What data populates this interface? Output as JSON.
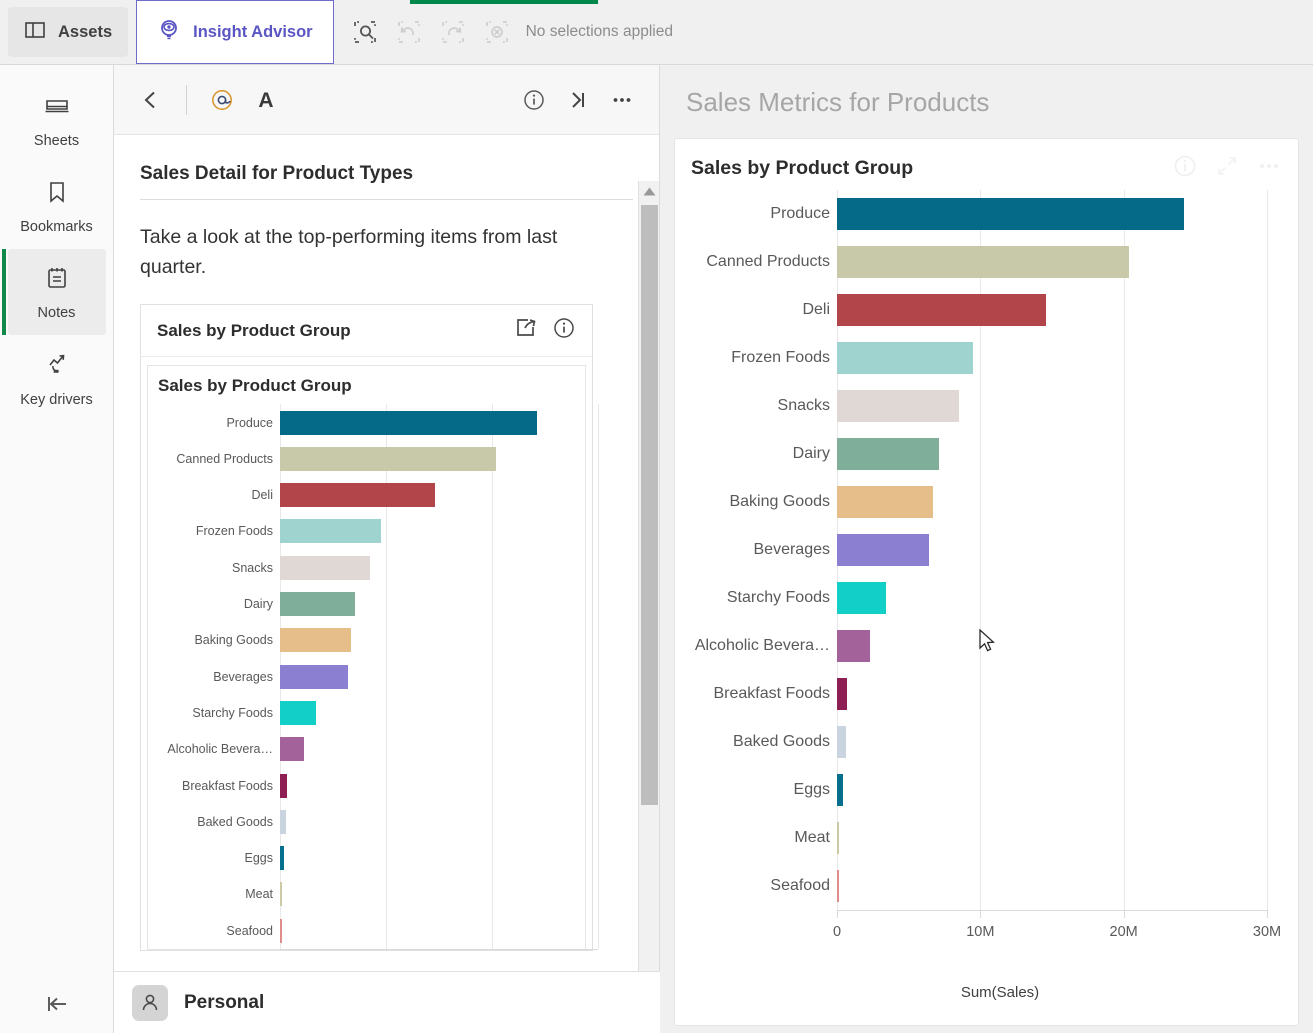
{
  "topbar": {
    "assets_label": "Assets",
    "insight_advisor_label": "Insight Advisor",
    "selection_status": "No selections applied",
    "icons": {
      "assets": "panel-icon",
      "insight_advisor": "lightbulb-eye-icon",
      "selection_search": "selection-search-icon",
      "undo": "undo-icon",
      "redo": "redo-icon",
      "clear": "clear-selections-icon"
    },
    "accent_purple": "#6e6bcc",
    "progress_green": "#00884b"
  },
  "sidebar": {
    "items": [
      {
        "label": "Sheets",
        "icon": "sheets-icon",
        "active": false
      },
      {
        "label": "Bookmarks",
        "icon": "bookmark-icon",
        "active": false
      },
      {
        "label": "Notes",
        "icon": "notes-icon",
        "active": true
      },
      {
        "label": "Key drivers",
        "icon": "key-drivers-icon",
        "active": false
      }
    ],
    "collapse_icon": "collapse-left-icon",
    "active_indicator_color": "#12884a"
  },
  "notes_panel": {
    "toolbar": {
      "back": "back-chevron-icon",
      "mention": "at-mention-icon",
      "text_format": "text-format-icon",
      "info": "info-icon",
      "collapse": "collapse-right-icon",
      "more": "more-options-icon"
    },
    "note_title": "Sales Detail for Product Types",
    "note_paragraph": "Take a look at the top-performing items from last quarter.",
    "embedded_card": {
      "header_title": "Sales by Product Group",
      "share_icon": "share-external-icon",
      "info_icon": "info-icon",
      "chart_title": "Sales by Product Group"
    }
  },
  "right_panel": {
    "title": "Sales Metrics for Products",
    "card": {
      "title": "Sales by Product Group",
      "info_icon": "info-icon",
      "expand_icon": "expand-icon",
      "more_icon": "more-options-icon"
    }
  },
  "bottombar": {
    "avatar_icon": "person-avatar-icon",
    "name": "Personal"
  },
  "colors": {
    "bars": [
      "#056a87",
      "#c8c9a9",
      "#b1454a",
      "#9fd3d0",
      "#e0d8d4",
      "#7fae9a",
      "#e6be8a",
      "#8b7fd1",
      "#12cfc8",
      "#a3629a",
      "#8e1f52",
      "#c9d4de",
      "#08708f",
      "#cdc9a5",
      "#de8c8c"
    ]
  },
  "chart_data": {
    "type": "bar",
    "orientation": "horizontal",
    "title": "Sales by Product Group",
    "xlabel": "Sum(Sales)",
    "ylabel": "",
    "xlim": [
      0,
      30000000
    ],
    "xticks": [
      0,
      10000000,
      20000000,
      30000000
    ],
    "xticklabels": [
      "0",
      "10M",
      "20M",
      "30M"
    ],
    "grid": true,
    "legend": "none",
    "categories": [
      "Produce",
      "Canned Products",
      "Deli",
      "Frozen Foods",
      "Snacks",
      "Dairy",
      "Baking Goods",
      "Beverages",
      "Starchy Foods",
      "Alcoholic Bevera…",
      "Breakfast Foods",
      "Baked Goods",
      "Eggs",
      "Meat",
      "Seafood"
    ],
    "values": [
      24200000,
      20400000,
      14600000,
      9500000,
      8500000,
      7100000,
      6700000,
      6400000,
      3400000,
      2300000,
      700000,
      600000,
      400000,
      150000,
      120000
    ]
  }
}
